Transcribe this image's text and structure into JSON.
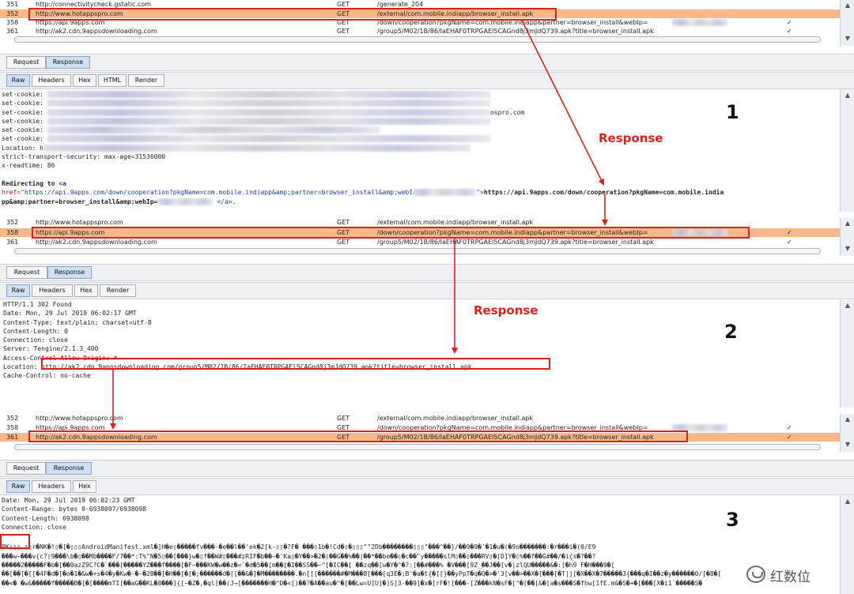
{
  "panel1": {
    "history": [
      {
        "num": "351",
        "url": "http://connectivitycheck.gstatic.com",
        "method": "GET",
        "path": "/generate_204",
        "checked": false,
        "selected": false
      },
      {
        "num": "352",
        "url": "http://www.hotappspro.com",
        "method": "GET",
        "path": "/external/com.mobile.indiapp/browser_install.apk",
        "checked": false,
        "selected": true
      },
      {
        "num": "358",
        "url": "https://api.9apps.com",
        "method": "GET",
        "path": "/down/cooperation?pkgName=com.mobile.indiapp&partner=browser_install&webIp=",
        "checked": true,
        "selected": false
      },
      {
        "num": "361",
        "url": "http://ak2.cdn.9appsdownloading.com",
        "method": "GET",
        "path": "/group5/M02/1B/86/IaEHAF0TRPGAEl5CAGnd8j3mJdQ739.apk?title=browser_install.apk",
        "checked": true,
        "selected": false
      }
    ],
    "tabs": [
      "Request",
      "Response"
    ],
    "subtabs": [
      "Raw",
      "Headers",
      "Hex",
      "HTML",
      "Render"
    ],
    "lines": {
      "h1": "set-cookie:",
      "h2": "set-cookie:",
      "h3": "set-cookie:",
      "h3_tail": "ospro.com",
      "h4": "set-cookie:",
      "h5": "set-cookie:",
      "h6": "set-cookie:",
      "h7": "Location: h",
      "h8": "strict-transport-security: max-age=31536000",
      "h9": "x-readtime: 86",
      "redir_a": "Redirecting to ",
      "redir_b": "<a",
      "href_attr": "href=",
      "href_val": "\"https://api.9apps.com/down/cooperation?pkgName=com.mobile.indiapp&amp;partner=browser_install&amp;webI",
      "href_end": "\">",
      "href_text": "https://api.9apps.com/down/cooperation?pkgName=com.mobile.india",
      "href_text2": "pp&amp;partner=browser_install&amp;webIp=",
      "close_a": "</a>",
      "close_dot": "."
    },
    "step": "1",
    "response_label": "Response"
  },
  "panel2": {
    "history": [
      {
        "num": "352",
        "url": "http://www.hotappspro.com",
        "method": "GET",
        "path": "/external/com.mobile.indiapp/browser_install.apk",
        "checked": false,
        "selected": false
      },
      {
        "num": "358",
        "url": "https://api.9apps.com",
        "method": "GET",
        "path": "/down/cooperation?pkgName=com.mobile.indiapp&partner=browser_install&webIp=",
        "checked": true,
        "selected": true
      },
      {
        "num": "361",
        "url": "http://ak2.cdn.9appsdownloading.com",
        "method": "GET",
        "path": "/group5/M02/1B/86/IaEHAF0TRPGAEl5CAGnd8j3mJdQ739.apk?title=browser_install.apk",
        "checked": true,
        "selected": false
      }
    ],
    "tabs": [
      "Request",
      "Response"
    ],
    "subtabs": [
      "Raw",
      "Headers",
      "Hex",
      "Render"
    ],
    "lines": [
      "HTTP/1.1 302 Found",
      "Date: Mon, 29 Jul 2019 06:02:17 GMT",
      "Content-Type: text/plain; charset=utf-8",
      "Content-Length: 0",
      "Connection: close",
      "Server: Tengine/2.1.3_400",
      "Access-Control-Allow-Origin: *"
    ],
    "location_label": "Location: ",
    "location_url": "http://ak2.cdn.9appsdownloading.com/group5/M02/1B/86/IaEHAF0TRPGAEl5CAGnd8j3mJdQ739.apk?title=browser_install.apk",
    "cache_line": "Cache-Control: no-cache",
    "step": "2",
    "response_label": "Response"
  },
  "panel3": {
    "history": [
      {
        "num": "352",
        "url": "http://www.hotappspro.com",
        "method": "GET",
        "path": "/external/com.mobile.indiapp/browser_install.apk",
        "checked": false,
        "selected": false
      },
      {
        "num": "358",
        "url": "https://api.9apps.com",
        "method": "GET",
        "path": "/down/cooperation?pkgName=com.mobile.indiapp&partner=browser_install&webIp=",
        "checked": true,
        "selected": false
      },
      {
        "num": "361",
        "url": "http://ak2.cdn.9appsdownloading.com",
        "method": "GET",
        "path": "/group5/M02/1B/86/IaEHAF0TRPGAEl5CAGnd8j3mJdQ739.apk?title=browser_install.apk",
        "checked": true,
        "selected": true
      }
    ],
    "tabs": [
      "Request",
      "Response"
    ],
    "subtabs": [
      "Raw",
      "Headers",
      "Hex"
    ],
    "lines": [
      "Date: Mon, 29 Jul 2019 06:02:23 GMT",
      "Content-Range: bytes 0-6938097/6938098",
      "Content-Length: 6938098",
      "Connection: close"
    ],
    "pk_prefix": "PK▯▯▯",
    "binary": [
      "▯▯r�NK�!▯�[�▯▯▯AndroidManifest.xml�]H�e▯�����fv���-�e��l��'ek�2[k-▯▯�?F�  ���▯1b�!Cd�▯�▯▯▯\"\"2Db��������▯▯▯\"���^��}/��9�9�'�1�u�(�9o�������:�r���i�(0/E9",
      "���w~���v{c?▯9���\\b�▯��Mb����F/7��*:T%\"N�5▯��[���}w�▯f��W#▯���#zRIF�b��~�'Ka▯�Y��>�2�▯��G��%��|��*��be��▯�c��\"y�����slM▯��▯���RV▯�[D]Y�▯%��f��G#��/�i{s�?��?",
      "�����2�����F�b�[��0azZ9C?C�`���[�����YZ���f����[�F~���KW�w��z�=`�d�5��[m��[�I��SS��~^[�IC��[ ��zq��[w�Y�^�?:[��#���% �V���[9Z_��J��[v�|zlQU�����&�:[�h9 F�H���9�[",
      "��[��[�[[�4F�d�[�o�1�&w�+s�4�y�Kw�-�-�2B��[�H��[�[�;������d�[[��&�]�M��������.�n[[[������#�M���8[���[q3E�;B'�a�t{�[[}��yPpT�q�Q�>�'3[v��>��X�[���[�T|j[�X��X�7�����3{���q�I��z�y������0/[�8�[",
      "��<� �w&�����f�����B�[�[����mTI[��aG��KL�8���]{[~�Z�,�ql[��(J→[�������H�^D�<[)��?�A��au�^�[��Lw=U]U]�]S]3-��9]�x�[rF�![���-[Z���kN�sF�[^�[��[&�[a�s���S�fhw[1fE.m&�S�+�[���[X�i1`�����S�"
    ],
    "step": "3"
  },
  "watermark": "红数位",
  "colors": {
    "highlight_row": "#f9b88a",
    "annotation_red": "#e01e1e",
    "active_tab": "#cfe0f2"
  }
}
